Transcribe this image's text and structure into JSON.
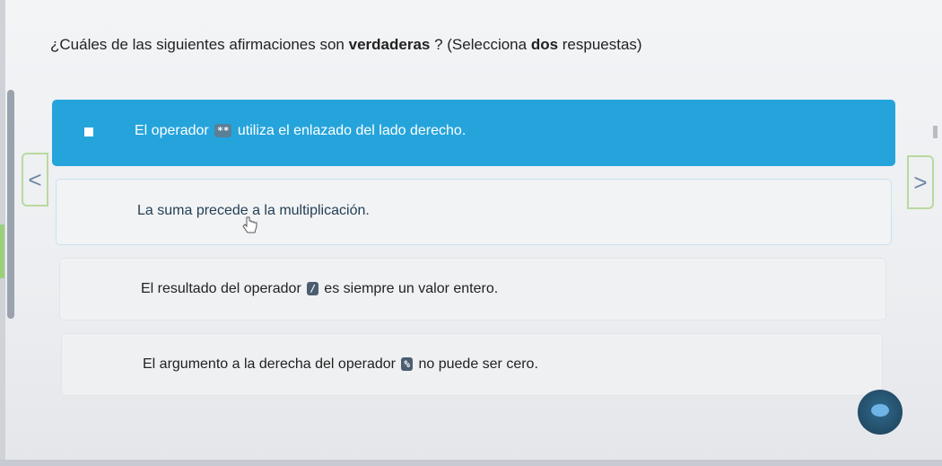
{
  "question": {
    "prefix": "¿Cuáles de las siguientes afirmaciones son ",
    "bold1": "verdaderas",
    "middle": " ? (Selecciona ",
    "bold2": "dos",
    "suffix": " respuestas)"
  },
  "options": [
    {
      "pre": "El operador ",
      "chip": "**",
      "post": " utiliza el enlazado del lado derecho.",
      "selected": true
    },
    {
      "text": "La suma precede a la multiplicación.",
      "selected": false
    },
    {
      "pre": "El resultado del operador ",
      "chip": "/",
      "post": " es siempre un valor entero.",
      "selected": false
    },
    {
      "pre": "El argumento a la derecha del operador ",
      "chip": "%",
      "post": " no puede ser cero.",
      "selected": false
    }
  ],
  "nav": {
    "prev_icon": "chevron-left-icon",
    "prev_glyph": "<",
    "next_icon": "chevron-right-icon",
    "next_glyph": ">"
  },
  "colors": {
    "selected_bg": "#25a4dc",
    "nav_border": "#b9d99f"
  }
}
